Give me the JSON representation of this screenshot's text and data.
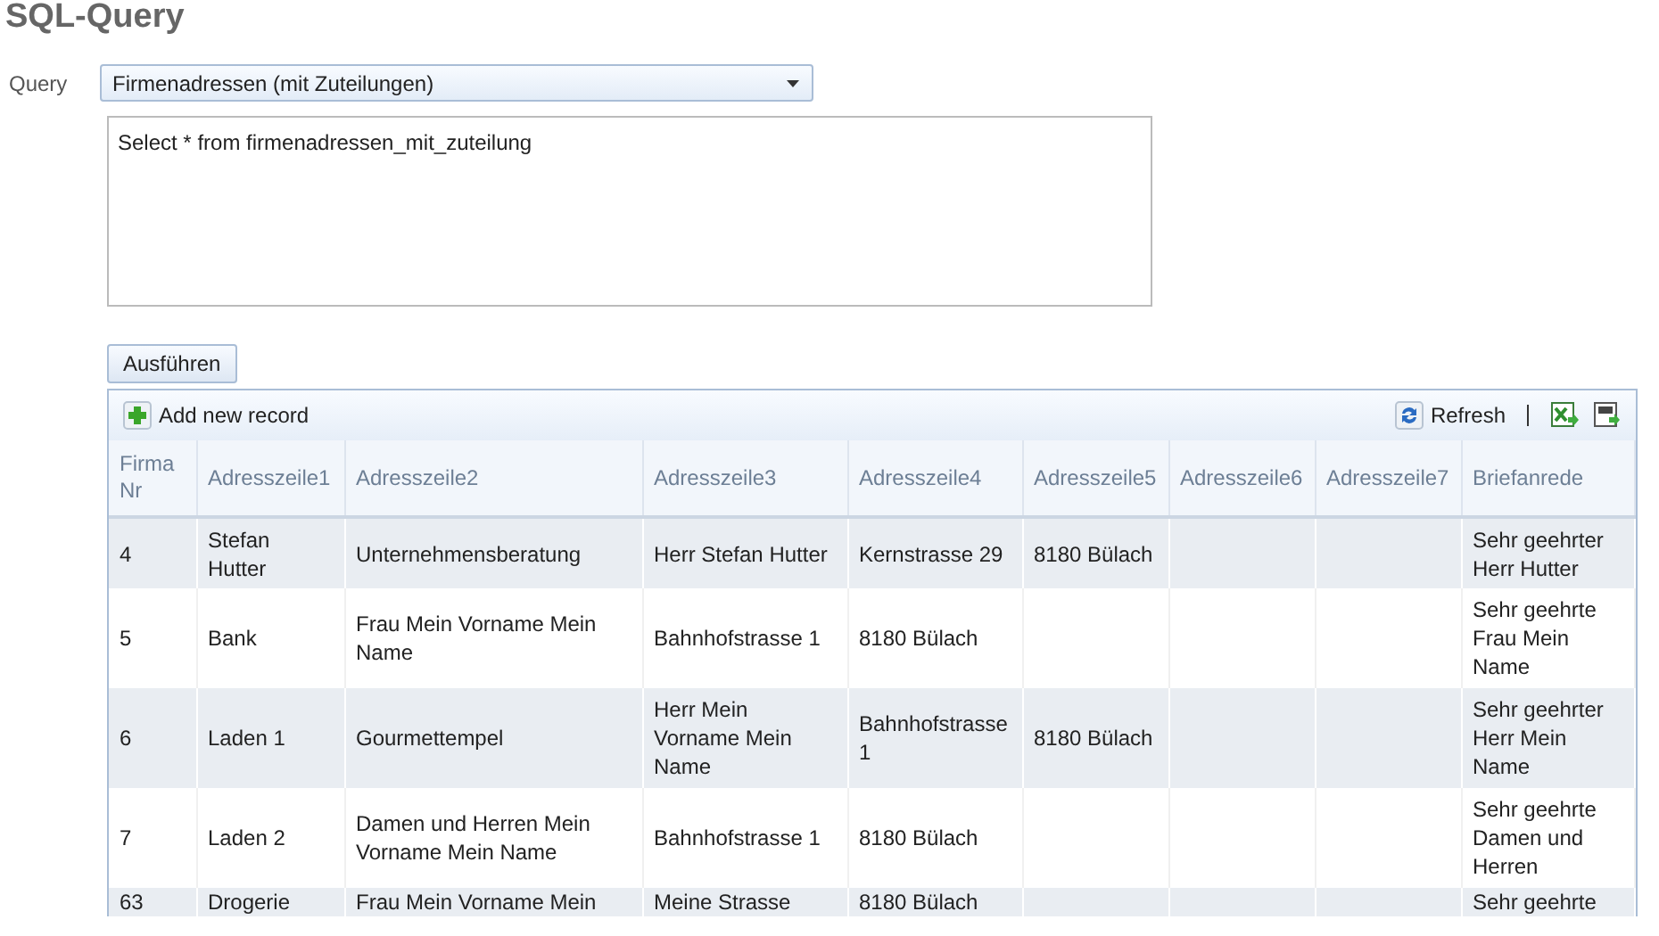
{
  "page_title": "SQL-Query",
  "query": {
    "label": "Query",
    "selected_option": "Firmenadressen (mit Zuteilungen)",
    "sql": "Select * from firmenadressen_mit_zuteilung"
  },
  "run_button": "Ausführen",
  "grid": {
    "toolbar": {
      "add_label": "Add new record",
      "refresh_label": "Refresh"
    },
    "columns": [
      "Firma Nr",
      "Adresszeile1",
      "Adresszeile2",
      "Adresszeile3",
      "Adresszeile4",
      "Adresszeile5",
      "Adresszeile6",
      "Adresszeile7",
      "Briefanrede"
    ],
    "rows": [
      {
        "cells": [
          "4",
          "Stefan Hutter",
          "Unternehmensberatung",
          "Herr Stefan Hutter",
          "Kernstrasse 29",
          "8180 Bülach",
          "",
          "",
          "Sehr geehrter Herr Hutter"
        ]
      },
      {
        "cells": [
          "5",
          "Bank",
          "Frau Mein Vorname Mein Name",
          "Bahnhofstrasse 1",
          "8180 Bülach",
          "",
          "",
          "",
          "Sehr geehrte Frau Mein Name"
        ]
      },
      {
        "cells": [
          "6",
          "Laden 1",
          "Gourmettempel",
          "Herr Mein Vorname Mein Name",
          "Bahnhofstrasse 1",
          "8180 Bülach",
          "",
          "",
          "Sehr geehrter Herr Mein Name"
        ]
      },
      {
        "cells": [
          "7",
          "Laden 2",
          "Damen und Herren Mein Vorname Mein Name",
          "Bahnhofstrasse 1",
          "8180 Bülach",
          "",
          "",
          "",
          "Sehr geehrte Damen und Herren"
        ]
      },
      {
        "cells": [
          "63",
          "Drogerie",
          "Frau Mein Vorname Mein",
          "Meine Strasse",
          "8180 Bülach",
          "",
          "",
          "",
          "Sehr geehrte"
        ]
      }
    ]
  }
}
